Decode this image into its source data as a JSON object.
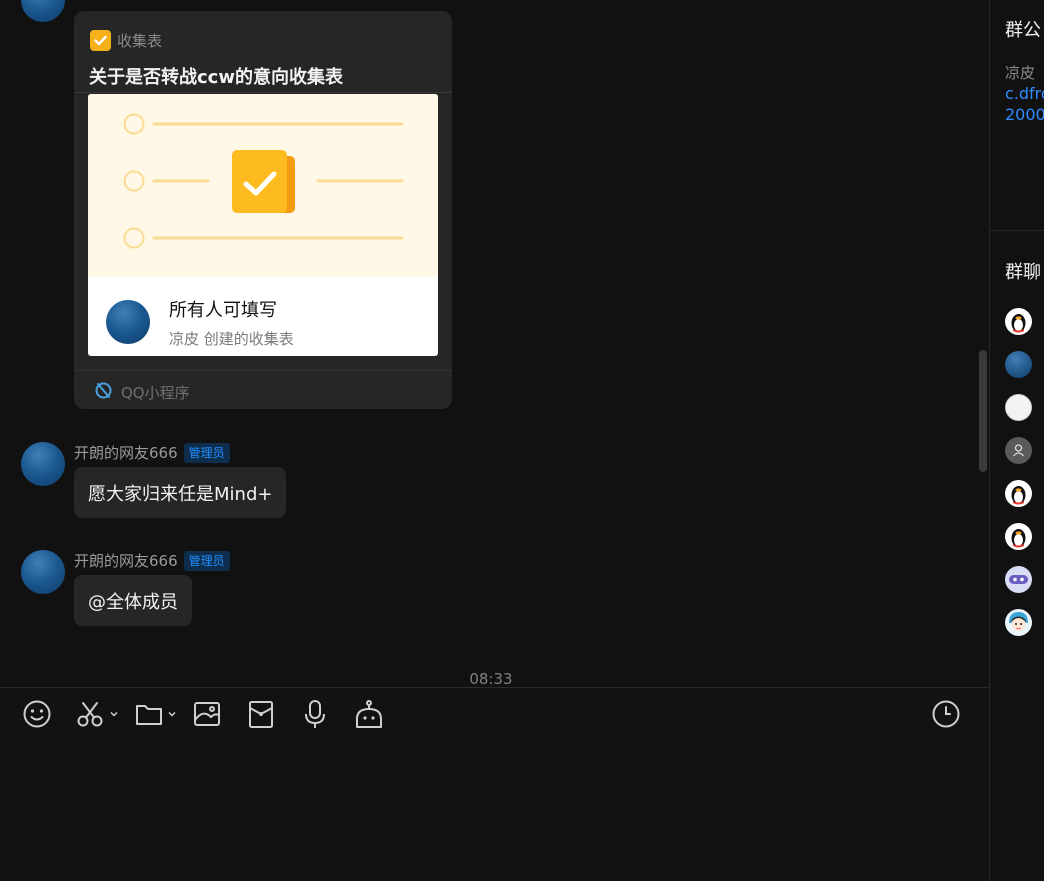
{
  "chat": {
    "card": {
      "app_name": "收集表",
      "title": "关于是否转战ccw的意向收集表",
      "preview_title": "所有人可填写",
      "preview_subtitle": "凉皮 创建的收集表",
      "footer": "QQ小程序"
    },
    "messages": [
      {
        "sender": "开朗的网友666",
        "badge": "管理员",
        "text": "愿大家归来任是Mind+"
      },
      {
        "sender": "开朗的网友666",
        "badge": "管理员",
        "text": "@全体成员"
      }
    ],
    "timestamp": "08:33"
  },
  "toolbar": {
    "items": [
      "emoji-icon",
      "scissors-icon",
      "folder-icon",
      "image-icon",
      "red-envelope-icon",
      "microphone-icon",
      "robot-icon",
      "history-clock-icon"
    ]
  },
  "right_panel": {
    "notice_title": "群公",
    "notice_text": "凉皮",
    "notice_link_1": "c.dfro",
    "notice_link_2": "2000",
    "members_title": "群聊"
  },
  "colors": {
    "background": "#111111",
    "bubble": "#262626",
    "accent": "#1f8fff",
    "card_check": "#f5b01a"
  }
}
